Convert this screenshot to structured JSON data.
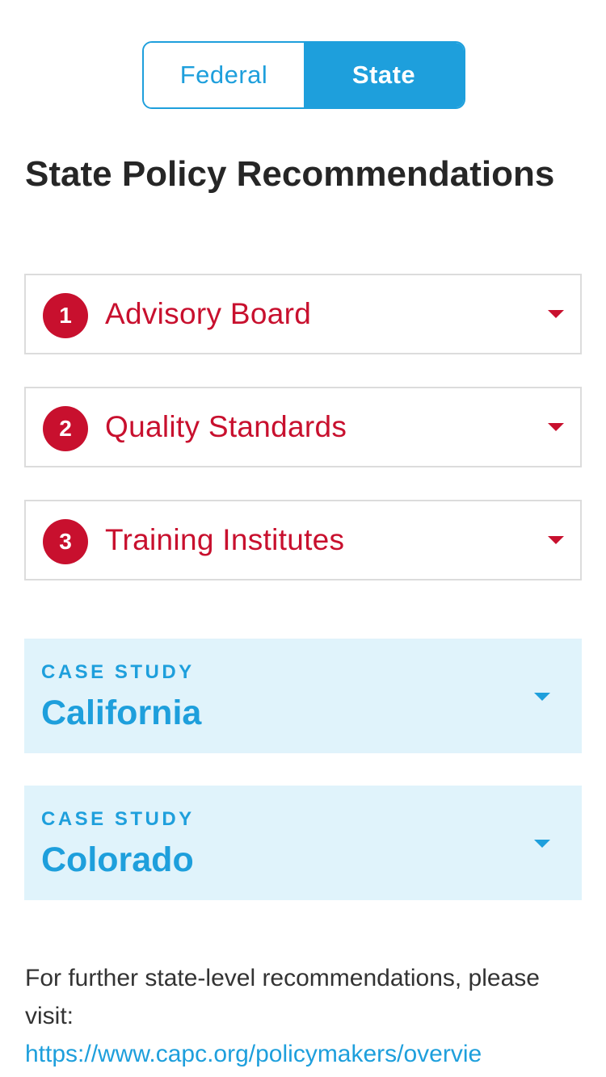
{
  "toggle": {
    "federal_label": "Federal",
    "state_label": "State",
    "selected": "State"
  },
  "page_title": "State Policy Recommendations",
  "recommendations": [
    {
      "number": "1",
      "label": "Advisory Board",
      "icon": "caret-down-icon"
    },
    {
      "number": "2",
      "label": "Quality Standards",
      "icon": "caret-down-icon"
    },
    {
      "number": "3",
      "label": "Training Institutes",
      "icon": "caret-down-icon"
    }
  ],
  "case_studies": [
    {
      "eyebrow": "CASE STUDY",
      "title": "California",
      "icon": "caret-down-icon"
    },
    {
      "eyebrow": "CASE STUDY",
      "title": "Colorado",
      "icon": "caret-down-icon"
    }
  ],
  "footer": {
    "text": "For further state-level recommendations, please visit:",
    "link_text": "https://www.capc.org/policymakers/overvie"
  },
  "colors": {
    "accent_blue": "#1e9fdc",
    "accent_red": "#c8102e",
    "case_bg": "#e0f3fb",
    "border_gray": "#dcdcdc"
  }
}
